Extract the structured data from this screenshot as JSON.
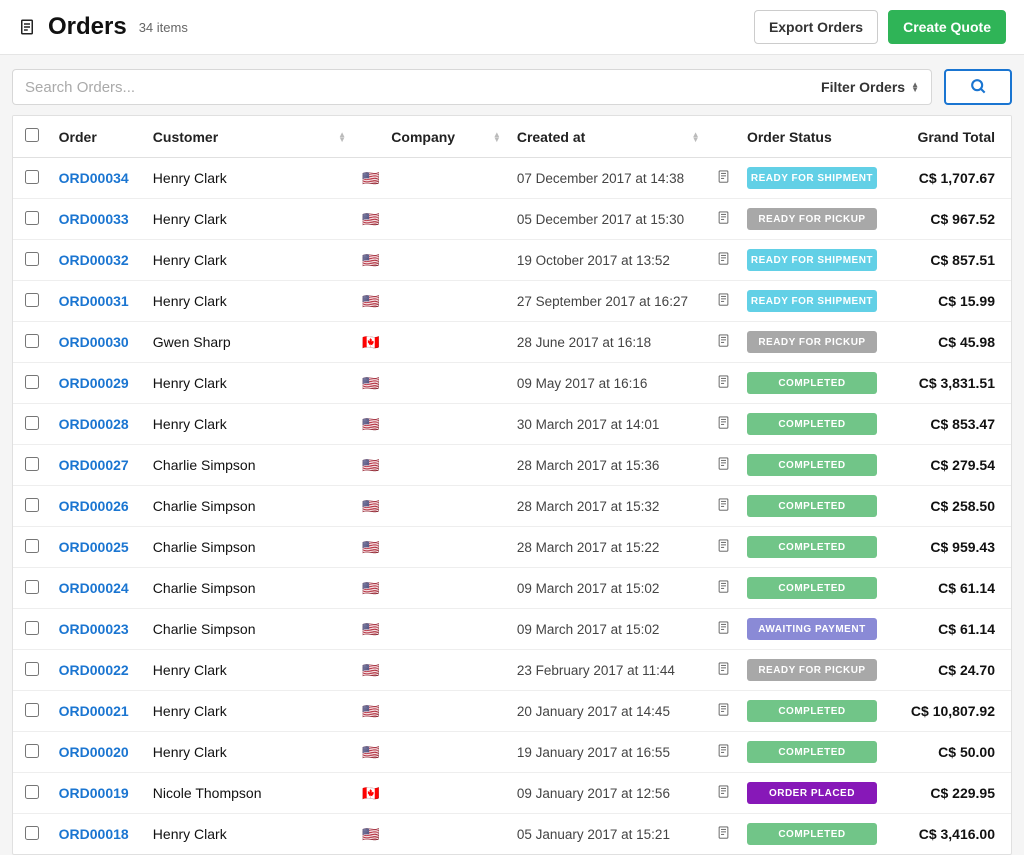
{
  "header": {
    "title": "Orders",
    "item_count": "34 items",
    "export_label": "Export Orders",
    "create_quote_label": "Create Quote"
  },
  "search": {
    "placeholder": "Search Orders...",
    "filter_label": "Filter Orders"
  },
  "columns": {
    "order": "Order",
    "customer": "Customer",
    "company": "Company",
    "created_at": "Created at",
    "order_status": "Order Status",
    "grand_total": "Grand Total"
  },
  "status_labels": {
    "ready_for_shipment": "READY FOR SHIPMENT",
    "ready_for_pickup": "READY FOR PICKUP",
    "completed": "COMPLETED",
    "awaiting_payment": "AWAITING PAYMENT",
    "order_placed": "ORDER PLACED"
  },
  "flags": {
    "us": "🇺🇸",
    "ca": "🇨🇦"
  },
  "orders": [
    {
      "id": "ORD00034",
      "customer": "Henry Clark",
      "flag": "us",
      "created": "07 December 2017 at 14:38",
      "receipt": true,
      "status": "ready_for_shipment",
      "total": "C$ 1,707.67"
    },
    {
      "id": "ORD00033",
      "customer": "Henry Clark",
      "flag": "us",
      "created": "05 December 2017 at 15:30",
      "receipt": true,
      "status": "ready_for_pickup",
      "total": "C$ 967.52"
    },
    {
      "id": "ORD00032",
      "customer": "Henry Clark",
      "flag": "us",
      "created": "19 October 2017 at 13:52",
      "receipt": true,
      "status": "ready_for_shipment",
      "total": "C$ 857.51"
    },
    {
      "id": "ORD00031",
      "customer": "Henry Clark",
      "flag": "us",
      "created": "27 September 2017 at 16:27",
      "receipt": true,
      "status": "ready_for_shipment",
      "total": "C$ 15.99"
    },
    {
      "id": "ORD00030",
      "customer": "Gwen Sharp",
      "flag": "ca",
      "created": "28 June 2017 at 16:18",
      "receipt": true,
      "status": "ready_for_pickup",
      "total": "C$ 45.98"
    },
    {
      "id": "ORD00029",
      "customer": "Henry Clark",
      "flag": "us",
      "created": "09 May 2017 at 16:16",
      "receipt": true,
      "status": "completed",
      "total": "C$ 3,831.51"
    },
    {
      "id": "ORD00028",
      "customer": "Henry Clark",
      "flag": "us",
      "created": "30 March 2017 at 14:01",
      "receipt": true,
      "status": "completed",
      "total": "C$ 853.47"
    },
    {
      "id": "ORD00027",
      "customer": "Charlie Simpson",
      "flag": "us",
      "created": "28 March 2017 at 15:36",
      "receipt": true,
      "status": "completed",
      "total": "C$ 279.54"
    },
    {
      "id": "ORD00026",
      "customer": "Charlie Simpson",
      "flag": "us",
      "created": "28 March 2017 at 15:32",
      "receipt": true,
      "status": "completed",
      "total": "C$ 258.50"
    },
    {
      "id": "ORD00025",
      "customer": "Charlie Simpson",
      "flag": "us",
      "created": "28 March 2017 at 15:22",
      "receipt": true,
      "status": "completed",
      "total": "C$ 959.43"
    },
    {
      "id": "ORD00024",
      "customer": "Charlie Simpson",
      "flag": "us",
      "created": "09 March 2017 at 15:02",
      "receipt": true,
      "status": "completed",
      "total": "C$ 61.14"
    },
    {
      "id": "ORD00023",
      "customer": "Charlie Simpson",
      "flag": "us",
      "created": "09 March 2017 at 15:02",
      "receipt": true,
      "status": "awaiting_payment",
      "total": "C$ 61.14"
    },
    {
      "id": "ORD00022",
      "customer": "Henry Clark",
      "flag": "us",
      "created": "23 February 2017 at 11:44",
      "receipt": true,
      "status": "ready_for_pickup",
      "total": "C$ 24.70"
    },
    {
      "id": "ORD00021",
      "customer": "Henry Clark",
      "flag": "us",
      "created": "20 January 2017 at 14:45",
      "receipt": true,
      "status": "completed",
      "total": "C$ 10,807.92"
    },
    {
      "id": "ORD00020",
      "customer": "Henry Clark",
      "flag": "us",
      "created": "19 January 2017 at 16:55",
      "receipt": true,
      "status": "completed",
      "total": "C$ 50.00"
    },
    {
      "id": "ORD00019",
      "customer": "Nicole Thompson",
      "flag": "ca",
      "created": "09 January 2017 at 12:56",
      "receipt": true,
      "status": "order_placed",
      "total": "C$ 229.95"
    },
    {
      "id": "ORD00018",
      "customer": "Henry Clark",
      "flag": "us",
      "created": "05 January 2017 at 15:21",
      "receipt": true,
      "status": "completed",
      "total": "C$ 3,416.00"
    }
  ]
}
